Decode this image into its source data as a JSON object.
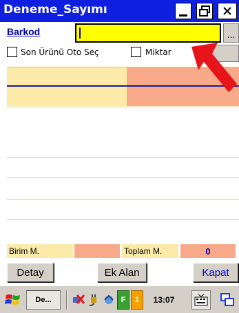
{
  "window": {
    "title": "Deneme_Sayımı"
  },
  "barkod": {
    "label": "Barkod",
    "value": "",
    "browse_label": "..."
  },
  "options": {
    "son_urunu_oto_sec": {
      "label": "Son Ürünü Oto Seç",
      "checked": false
    },
    "miktar": {
      "label": "Miktar",
      "checked": false
    }
  },
  "totals": {
    "birim_label": "Birim M.",
    "birim_value": "",
    "toplam_label": "Toplam M.",
    "toplam_value": "0"
  },
  "buttons": {
    "detay": "Detay",
    "ek_alan": "Ek Alan",
    "kapat": "Kapat"
  },
  "taskbar": {
    "app_label": "De...",
    "time": "13:07",
    "notification_f": "F",
    "notification_count": "1"
  },
  "colors": {
    "title_bar": "#0f1fe0",
    "input_yellow": "#ffff00",
    "cell_cream": "#fbeaa8",
    "cell_salmon": "#f8a98a",
    "grid_line": "#f5c842",
    "arrow": "#e8141c"
  }
}
